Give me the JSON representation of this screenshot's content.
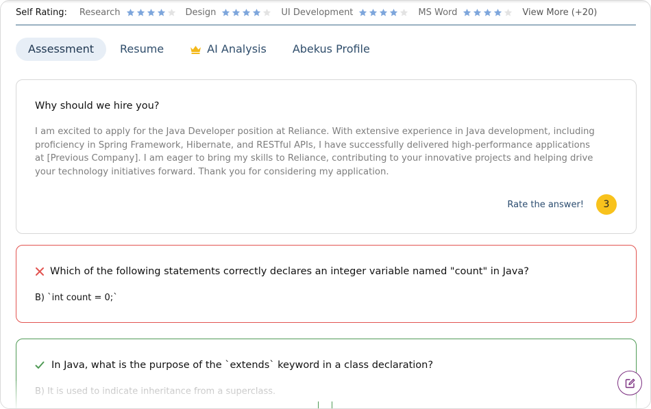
{
  "self_rating": {
    "label": "Self Rating:",
    "skills": [
      {
        "name": "Research",
        "stars": 4
      },
      {
        "name": "Design",
        "stars": 4
      },
      {
        "name": "UI Development",
        "stars": 4
      },
      {
        "name": "MS Word",
        "stars": 4
      }
    ],
    "max_stars": 5,
    "view_more": "View More (+20)"
  },
  "tabs": [
    {
      "label": "Assessment",
      "active": true
    },
    {
      "label": "Resume",
      "active": false
    },
    {
      "label": "AI Analysis",
      "active": false,
      "icon": "crown-icon"
    },
    {
      "label": "Abekus Profile",
      "active": false
    }
  ],
  "cards": [
    {
      "question": "Why should we hire you?",
      "answer": "I am excited to apply for the Java Developer position at Reliance. With extensive experience in Java development, including proficiency in Spring Framework, Hibernate, and RESTful APIs, I have successfully delivered high-performance applications at [Previous Company]. I am eager to bring my skills to Reliance, contributing to your innovative projects and helping drive your technology initiatives forward. Thank you for considering my application.",
      "rate_label": "Rate the answer!",
      "score": "3"
    },
    {
      "question": "Which of the following statements correctly declares an integer variable named \"count\" in Java?",
      "answer": "B) `int count = 0;`",
      "status": "wrong"
    },
    {
      "question": "In Java, what is the purpose of the `extends` keyword in a class declaration?",
      "answer": "B) It is used to indicate inheritance from a superclass.",
      "status": "correct"
    }
  ],
  "colors": {
    "star_filled": "#7ea6dc",
    "star_empty": "#e3e3e3",
    "accent_wrong": "#e2534f",
    "accent_correct": "#4f9a55",
    "badge": "#f8c21c",
    "fab_border": "#7a2d7f"
  },
  "fab": {
    "icon": "edit-note-icon"
  }
}
